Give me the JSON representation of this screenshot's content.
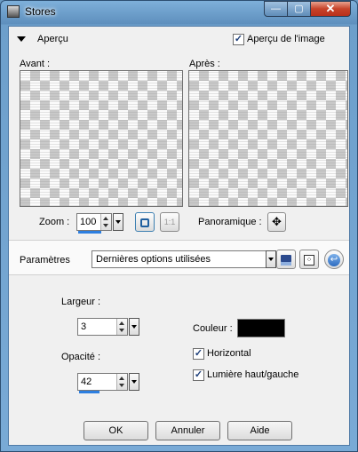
{
  "window": {
    "title": "Stores",
    "buttons": {
      "minimize": "—",
      "maximize": "▢",
      "close": "✕"
    }
  },
  "apercu": {
    "toggle_label": "Aperçu",
    "show_image_label": "Aperçu de l'image",
    "show_image_checked": true
  },
  "preview": {
    "before_label": "Avant :",
    "after_label": "Après :"
  },
  "zoom": {
    "label": "Zoom :",
    "value": "100",
    "one_to_one": "1:1"
  },
  "panoramique": {
    "label": "Panoramique :"
  },
  "params": {
    "label": "Paramètres",
    "preset_value": "Dernières options utilisées"
  },
  "fields": {
    "largeur": {
      "label": "Largeur :",
      "value": "3"
    },
    "opacite": {
      "label": "Opacité :",
      "value": "42",
      "level_percent": 42
    },
    "couleur": {
      "label": "Couleur :",
      "color": "#000000"
    },
    "horizontal": {
      "label": "Horizontal",
      "checked": true
    },
    "lumiere": {
      "label": "Lumière haut/gauche",
      "checked": true
    }
  },
  "footer": {
    "ok": "OK",
    "cancel": "Annuler",
    "help": "Aide"
  }
}
